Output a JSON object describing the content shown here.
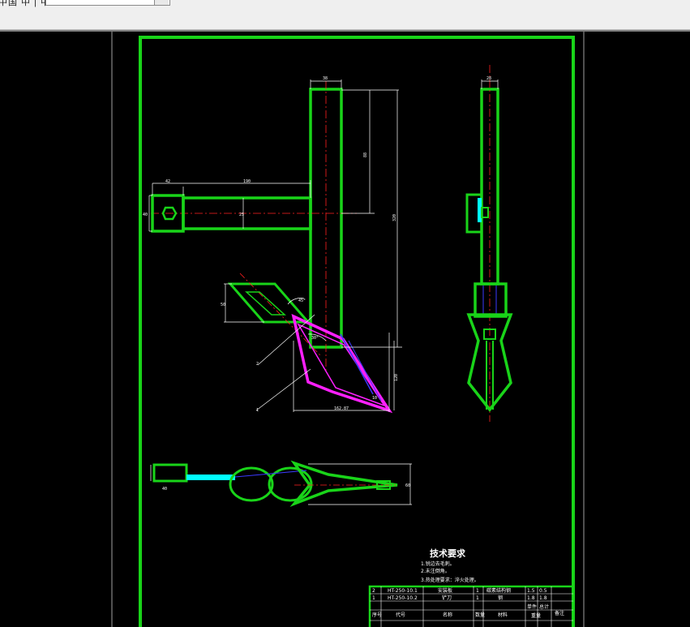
{
  "toolbar": {
    "label": "中国 中 | 中",
    "combo_value": ""
  },
  "drawing": {
    "tech_requirements_title": "技术要求",
    "tech_notes": [
      "1.锐边去毛刺。",
      "2.未注倒角。",
      "3.热处理要求：淬火处理。"
    ],
    "dims": {
      "top_width": "38",
      "top_right": "88",
      "right_total": "320",
      "left_box": "42",
      "left_arm_length": "190",
      "left_height": "40",
      "arm_mid": "25",
      "rhombus_left": "50",
      "angle_small": "45°",
      "angle_blade": "30°",
      "blade_width": "162.87",
      "blade_height": "120",
      "blade_small": "10",
      "callout_2": "2",
      "callout_1": "1",
      "side_top": "28",
      "bottom_left": "40",
      "bottom_right": "60"
    },
    "title_block": {
      "rows": [
        {
          "seq": "2",
          "code": "HT-250-10.1",
          "name": "安装板",
          "qty": "1",
          "material": "碳素结构钢",
          "weight": "1.5",
          "unit": "0.5"
        },
        {
          "seq": "1",
          "code": "HT-250-10.2",
          "name": "铲刀",
          "qty": "1",
          "material": "钢",
          "weight": "1.8",
          "unit": "1.8"
        }
      ],
      "header": {
        "seq": "序号",
        "code": "代号",
        "name": "名称",
        "qty": "数量",
        "material": "材料",
        "weight": "单件",
        "unit": "总计",
        "remark": "备注",
        "mass": "重量"
      }
    }
  },
  "colors": {
    "outline": "#19d419",
    "center": "#ff2020",
    "dimension": "#ffffff",
    "magenta": "#ff20ff",
    "cyan": "#00ffff",
    "blue": "#3a3aff"
  }
}
